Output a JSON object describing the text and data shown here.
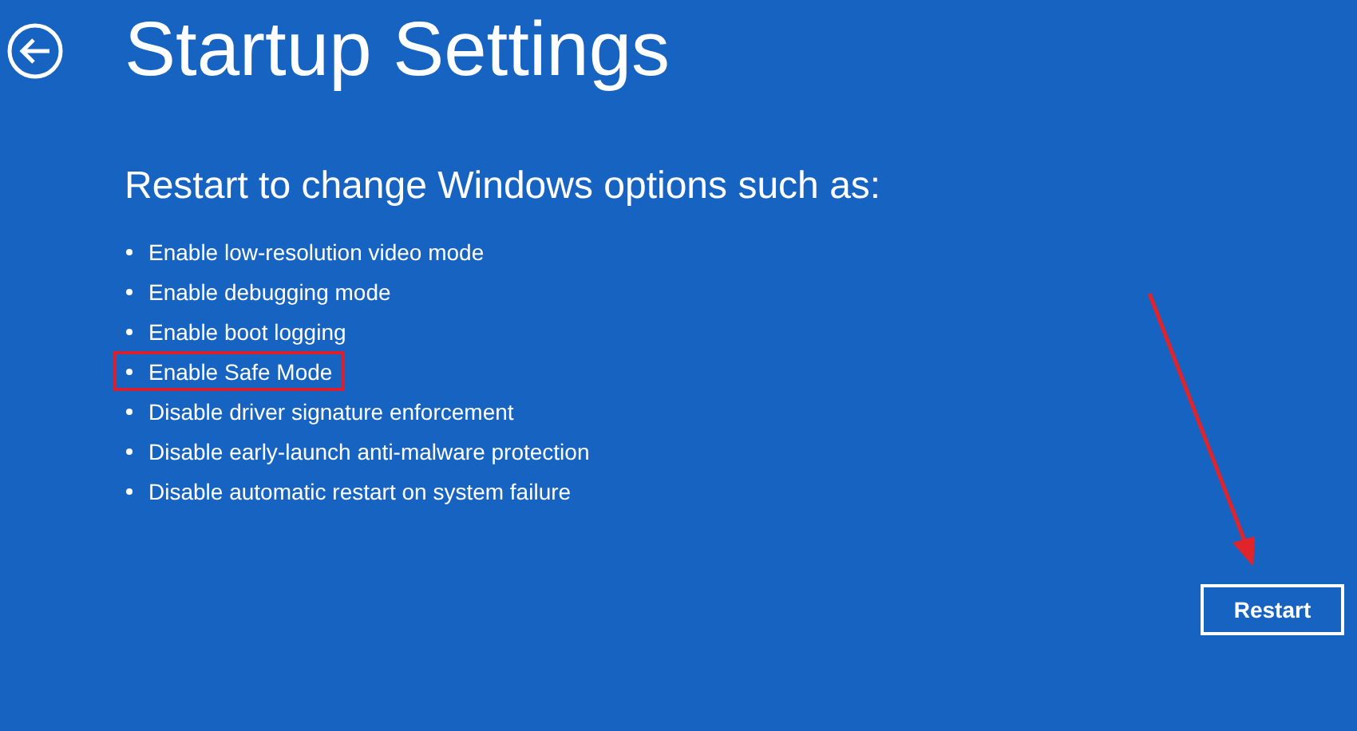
{
  "title": "Startup Settings",
  "subtitle": "Restart to change Windows options such as:",
  "options": [
    {
      "label": "Enable low-resolution video mode",
      "highlighted": false
    },
    {
      "label": "Enable debugging mode",
      "highlighted": false
    },
    {
      "label": "Enable boot logging",
      "highlighted": false
    },
    {
      "label": "Enable Safe Mode",
      "highlighted": true
    },
    {
      "label": "Disable driver signature enforcement",
      "highlighted": false
    },
    {
      "label": "Disable early-launch anti-malware protection",
      "highlighted": false
    },
    {
      "label": "Disable automatic restart on system failure",
      "highlighted": false
    }
  ],
  "restart_button": "Restart"
}
